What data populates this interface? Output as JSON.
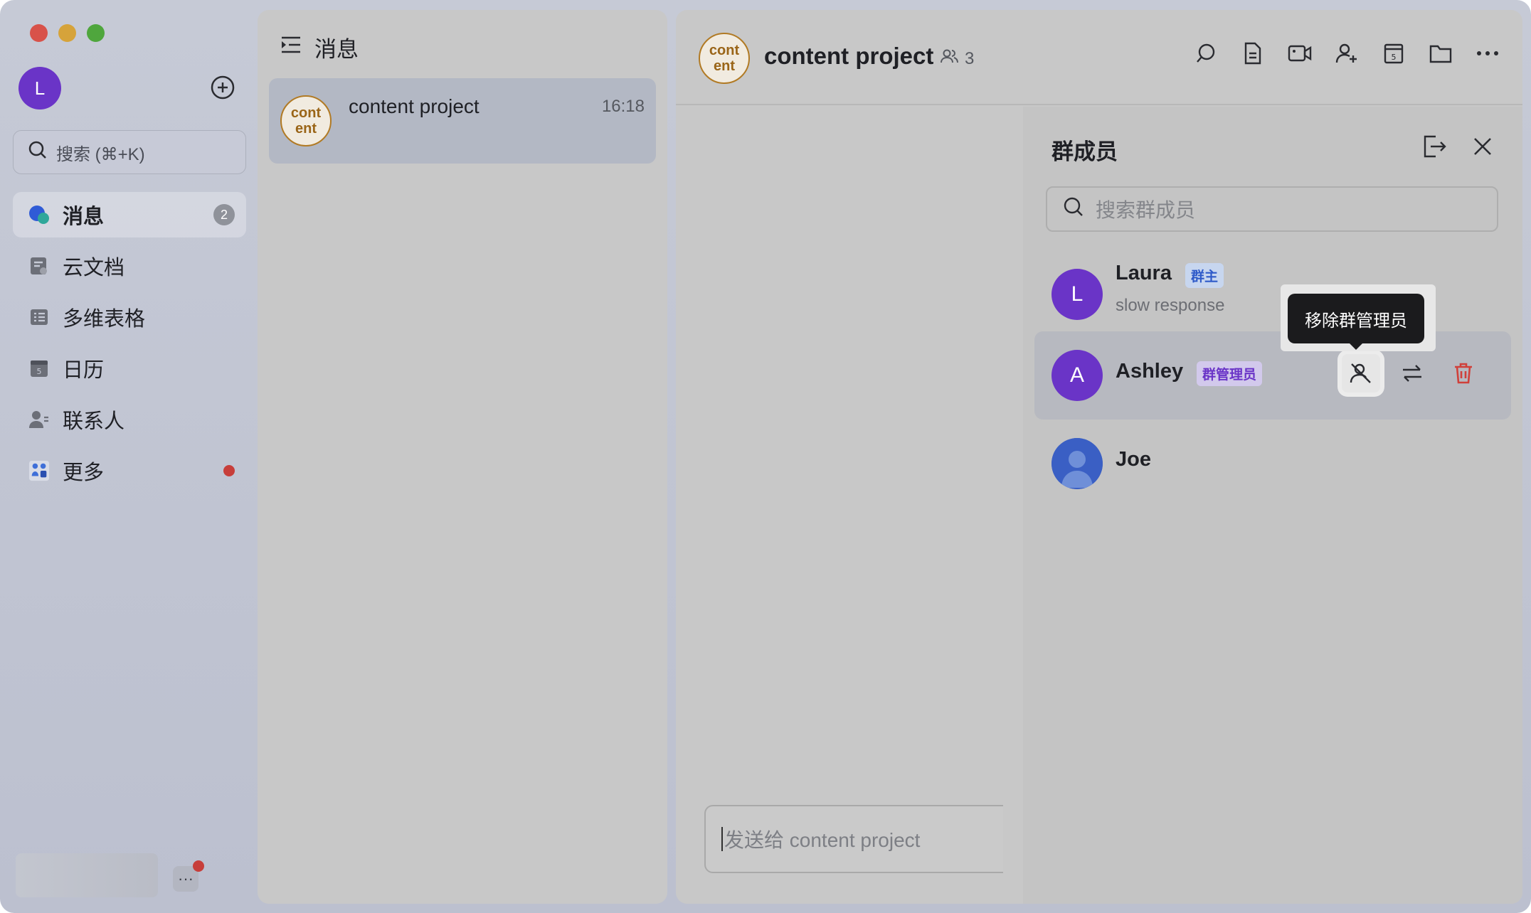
{
  "sidebar": {
    "user_initial": "L",
    "search_placeholder": "搜索 (⌘+K)",
    "items": [
      {
        "label": "消息",
        "badge": "2"
      },
      {
        "label": "云文档"
      },
      {
        "label": "多维表格"
      },
      {
        "label": "日历"
      },
      {
        "label": "联系人"
      },
      {
        "label": "更多"
      }
    ],
    "more_mini_label": "···"
  },
  "messages": {
    "header": "消息",
    "chats": [
      {
        "avatar_text": "cont ent",
        "name": "content project",
        "time": "16:18"
      }
    ]
  },
  "chat": {
    "avatar_text": "cont ent",
    "title": "content project",
    "member_count": "3",
    "composer_placeholder": "发送给 content project"
  },
  "members_panel": {
    "title": "群成员",
    "search_placeholder": "搜索群成员",
    "members": [
      {
        "initial": "L",
        "name": "Laura",
        "tag": "群主",
        "status": "slow response",
        "avatar_color": "#6a34c7"
      },
      {
        "initial": "A",
        "name": "Ashley",
        "tag": "群管理员",
        "avatar_color": "#6a34c7"
      },
      {
        "initial": "",
        "name": "Joe",
        "avatar_color": "#3a5fc4"
      }
    ],
    "tooltip": "移除群管理员"
  },
  "colors": {
    "owner_tag_bg": "#c7d6ef",
    "owner_tag_fg": "#2f5bc9",
    "admin_tag_bg": "#d2c9ec",
    "admin_tag_fg": "#6a34c7",
    "delete_red": "#d0403a"
  }
}
